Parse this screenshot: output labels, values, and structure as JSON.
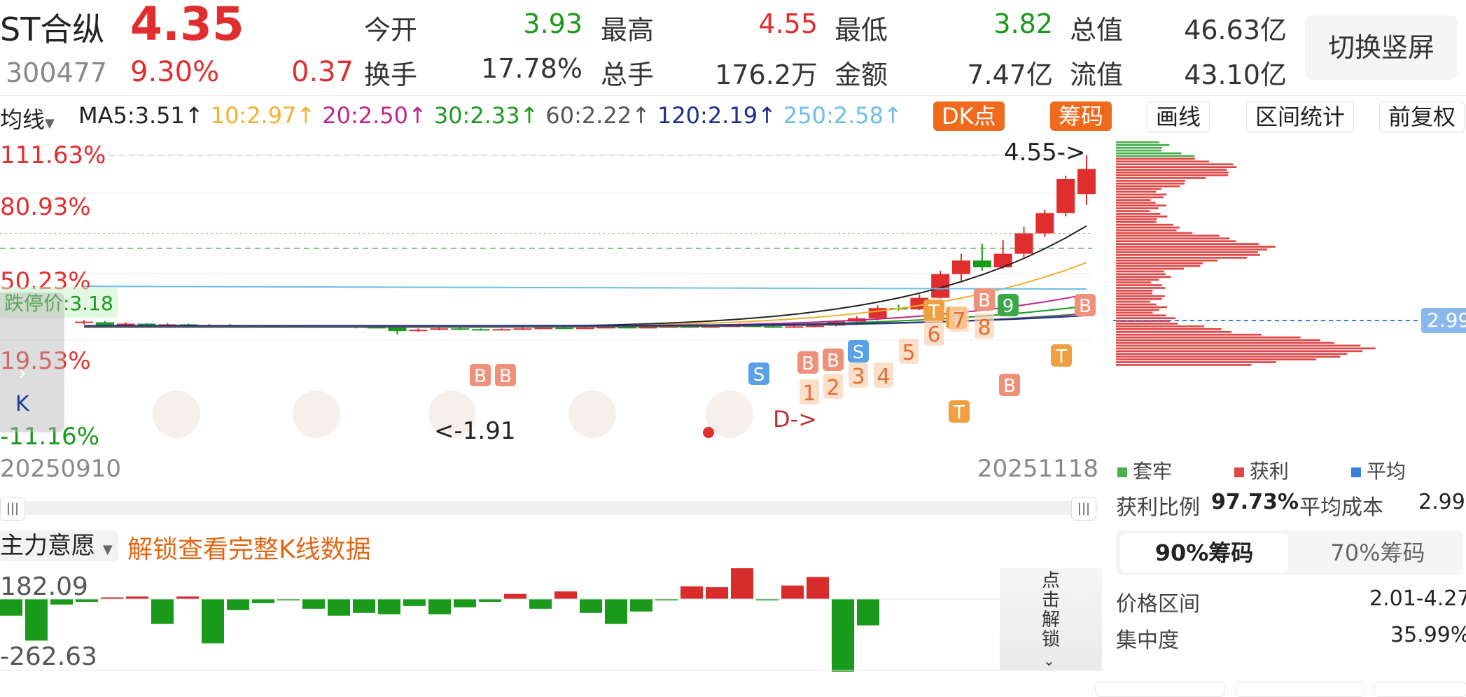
{
  "stock": {
    "name": "ST合纵",
    "code": "300477",
    "price": "4.35",
    "change_pct": "9.30%",
    "change": "0.37"
  },
  "stats": [
    {
      "label": "今开",
      "value": "3.93",
      "color": "#1a9a1a"
    },
    {
      "label": "最高",
      "value": "4.55",
      "color": "#e02e2e"
    },
    {
      "label": "最低",
      "value": "3.82",
      "color": "#1a9a1a"
    },
    {
      "label": "总值",
      "value": "46.63亿",
      "color": "#333333"
    },
    {
      "label": "换手",
      "value": "17.78%",
      "color": "#333333"
    },
    {
      "label": "总手",
      "value": "176.2万",
      "color": "#333333"
    },
    {
      "label": "金额",
      "value": "7.47亿",
      "color": "#333333"
    },
    {
      "label": "流值",
      "value": "43.10亿",
      "color": "#333333"
    }
  ],
  "switch_button": "切换竖屏",
  "ma_bar": {
    "selector": "均线",
    "items": [
      {
        "text": "MA5:3.51↑",
        "color": "#222222"
      },
      {
        "text": "10:2.97↑",
        "color": "#f0b030"
      },
      {
        "text": "20:2.50↑",
        "color": "#c0248a"
      },
      {
        "text": "30:2.33↑",
        "color": "#1a9a1a"
      },
      {
        "text": "60:2.22↑",
        "color": "#555555"
      },
      {
        "text": "120:2.19↑",
        "color": "#1c2e8c"
      },
      {
        "text": "250:2.58↑",
        "color": "#6cbde8"
      }
    ],
    "buttons": [
      "DK点",
      "筹码",
      "画线",
      "区间统计",
      "前复权"
    ]
  },
  "kline": {
    "y_labels": [
      "111.63%",
      "80.93%",
      "50.23%",
      "19.53%",
      "-11.16%"
    ],
    "limit_down_label": "跌停价:3.18",
    "max_marker": "4.55->",
    "min_marker": "<-1.91",
    "start_date": "20250910",
    "end_date": "20251118",
    "side_k_label": "K",
    "d_marker": "D->",
    "signal_letters": [
      "B",
      "B",
      "S",
      "B",
      "B",
      "S",
      "T",
      "B",
      "9",
      "B",
      "T",
      "T",
      "B",
      "T"
    ],
    "signal_numbers": [
      "1",
      "2",
      "3",
      "4",
      "5",
      "6",
      "7",
      "8"
    ]
  },
  "chart_data": {
    "type": "candlestick",
    "title": "ST合纵",
    "x_start": "20250910",
    "x_end": "20251118",
    "ylim": [
      1.91,
      4.55
    ],
    "limit_down": 3.18,
    "candles": [
      [
        2.08,
        2.1,
        2.06,
        2.12
      ],
      [
        2.09,
        2.05,
        2.04,
        2.11
      ],
      [
        2.06,
        2.07,
        2.04,
        2.09
      ],
      [
        2.07,
        2.05,
        2.04,
        2.08
      ],
      [
        2.05,
        2.06,
        2.03,
        2.08
      ],
      [
        2.06,
        2.04,
        2.03,
        2.07
      ],
      [
        2.04,
        2.05,
        2.02,
        2.06
      ],
      [
        2.05,
        2.04,
        2.03,
        2.06
      ],
      [
        2.04,
        2.03,
        2.02,
        2.05
      ],
      [
        2.03,
        2.04,
        2.02,
        2.05
      ],
      [
        2.04,
        2.03,
        2.01,
        2.05
      ],
      [
        2.03,
        2.02,
        2.01,
        2.04
      ],
      [
        2.02,
        2.03,
        2.01,
        2.04
      ],
      [
        2.03,
        2.02,
        2.0,
        2.04
      ],
      [
        2.02,
        2.01,
        2.0,
        2.03
      ],
      [
        2.01,
        1.96,
        1.91,
        2.02
      ],
      [
        1.96,
        1.98,
        1.95,
        2.0
      ],
      [
        1.98,
        2.0,
        1.97,
        2.02
      ],
      [
        2.0,
        1.99,
        1.98,
        2.02
      ],
      [
        1.99,
        1.98,
        1.97,
        2.0
      ],
      [
        1.98,
        1.99,
        1.97,
        2.0
      ],
      [
        1.99,
        2.0,
        1.98,
        2.01
      ],
      [
        2.0,
        2.01,
        1.99,
        2.02
      ],
      [
        2.01,
        2.0,
        1.99,
        2.02
      ],
      [
        2.0,
        2.01,
        1.99,
        2.02
      ],
      [
        2.01,
        2.02,
        2.0,
        2.03
      ],
      [
        2.02,
        2.01,
        2.0,
        2.03
      ],
      [
        2.01,
        2.02,
        2.0,
        2.03
      ],
      [
        2.02,
        2.03,
        2.01,
        2.04
      ],
      [
        2.03,
        2.02,
        2.01,
        2.04
      ],
      [
        2.02,
        2.03,
        2.01,
        2.04
      ],
      [
        2.03,
        2.04,
        2.02,
        2.05
      ],
      [
        2.04,
        2.03,
        2.02,
        2.05
      ],
      [
        2.03,
        2.02,
        2.01,
        2.04
      ],
      [
        2.02,
        2.03,
        2.01,
        2.04
      ],
      [
        2.03,
        2.04,
        2.02,
        2.06
      ],
      [
        2.04,
        2.1,
        2.03,
        2.12
      ],
      [
        2.1,
        2.15,
        2.08,
        2.18
      ],
      [
        2.15,
        2.3,
        2.12,
        2.34
      ],
      [
        2.3,
        2.28,
        2.26,
        2.35
      ],
      [
        2.28,
        2.45,
        2.27,
        2.5
      ],
      [
        2.45,
        2.8,
        2.44,
        2.85
      ],
      [
        2.8,
        3.0,
        2.7,
        3.1
      ],
      [
        3.0,
        2.9,
        2.85,
        3.25
      ],
      [
        2.9,
        3.1,
        2.88,
        3.3
      ],
      [
        3.1,
        3.4,
        3.05,
        3.5
      ],
      [
        3.4,
        3.7,
        3.35,
        3.75
      ],
      [
        3.7,
        4.2,
        3.65,
        4.25
      ],
      [
        3.98,
        4.35,
        3.82,
        4.55
      ]
    ],
    "ma_series": [
      {
        "name": "MA5",
        "last": 3.51,
        "color": "#222222"
      },
      {
        "name": "10",
        "last": 2.97,
        "color": "#f0b030"
      },
      {
        "name": "20",
        "last": 2.5,
        "color": "#c0248a"
      },
      {
        "name": "30",
        "last": 2.33,
        "color": "#1a9a1a"
      },
      {
        "name": "60",
        "last": 2.22,
        "color": "#555555"
      },
      {
        "name": "120",
        "last": 2.19,
        "color": "#1c2e8c"
      },
      {
        "name": "250",
        "last": 2.58,
        "color": "#6cbde8"
      }
    ],
    "indicator": {
      "name": "主力意愿",
      "ylim": [
        -262.63,
        182.09
      ],
      "values": [
        -60,
        -150,
        -20,
        -10,
        10,
        15,
        -90,
        15,
        -160,
        -40,
        -15,
        -5,
        -35,
        -60,
        -50,
        -55,
        -25,
        -55,
        -30,
        -10,
        30,
        -35,
        45,
        -50,
        -90,
        -45,
        -5,
        75,
        70,
        182,
        -5,
        80,
        130,
        -262,
        -95
      ]
    },
    "chip": {
      "avg_cost": 2.99,
      "profit_ratio": "97.73%",
      "price_range": "2.01-4.27",
      "concentration": "35.99%"
    }
  },
  "indicator_panel": {
    "selector": "主力意愿",
    "unlock_text": "解锁查看完整K线数据",
    "y_top": "182.09",
    "y_bottom": "-262.63",
    "unlock_button": "点击解锁"
  },
  "chip_panel": {
    "avg_tag": "2.99",
    "legend": [
      {
        "label": "套牢",
        "color": "#4caf50"
      },
      {
        "label": "获利",
        "color": "#e04848"
      },
      {
        "label": "平均",
        "color": "#3a7fe0"
      }
    ],
    "profit_label": "获利比例",
    "profit_value": "97.73%",
    "avg_label": "平均成本",
    "avg_value": "2.99",
    "tabs": [
      "90%筹码",
      "70%筹码"
    ],
    "range_label": "价格区间",
    "range_value": "2.01-4.27",
    "conc_label": "集中度",
    "conc_value": "35.99%"
  }
}
